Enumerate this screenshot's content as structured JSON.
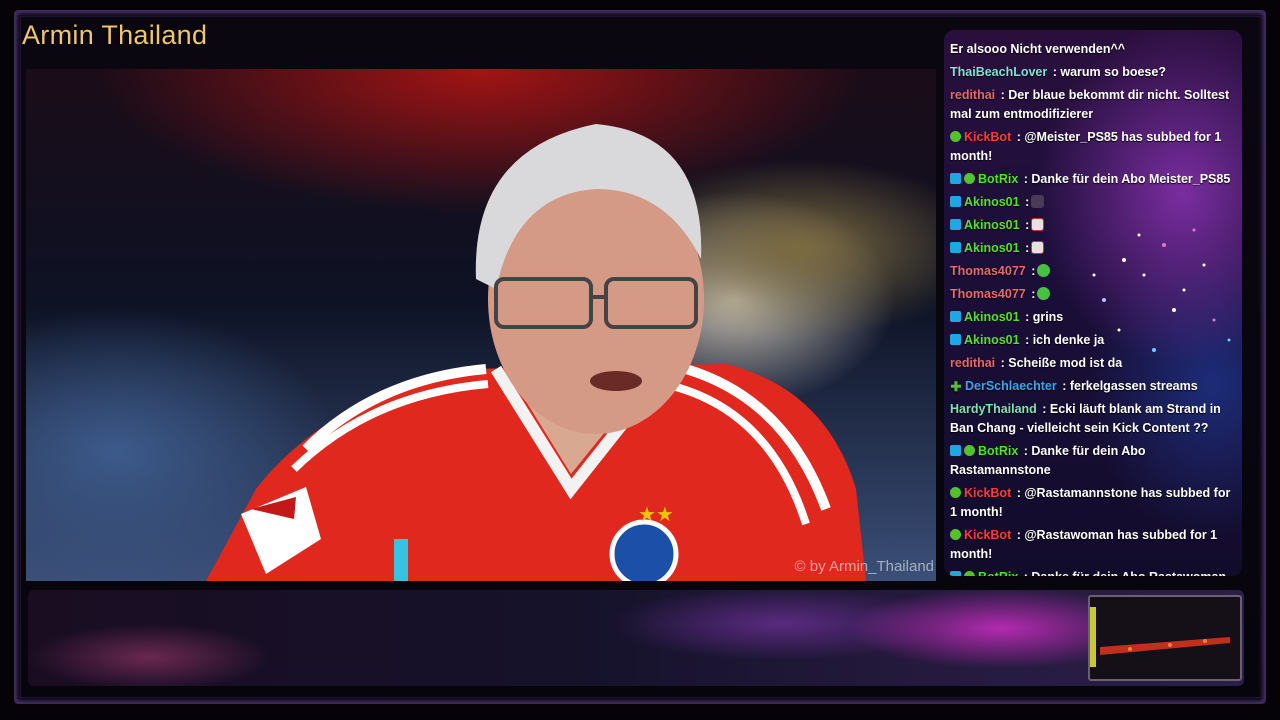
{
  "channel": {
    "title": "Armin Thailand"
  },
  "video": {
    "watermark": "© by Armin_Thailand"
  },
  "chat": {
    "messages": [
      {
        "user": "",
        "color": "#ffffff",
        "badges": [],
        "text": "Er alsooo Nicht verwenden^^"
      },
      {
        "user": "ThaiBeachLover",
        "color": "#7fe3d6",
        "badges": [],
        "text": " : warum so boese?"
      },
      {
        "user": "redithai",
        "color": "#e36a6a",
        "badges": [],
        "text": " : Der blaue bekommt dir nicht. Solltest mal zum entmodifizierer"
      },
      {
        "user": "KickBot",
        "color": "#ff3b3b",
        "badges": [
          "verified"
        ],
        "text": " : @Meister_PS85 has subbed for 1 month!"
      },
      {
        "user": "BotRix",
        "color": "#53e22b",
        "badges": [
          "mod",
          "verified"
        ],
        "text": " : Danke für dein Abo Meister_PS85"
      },
      {
        "user": "Akinos01",
        "color": "#53e22b",
        "badges": [
          "mod"
        ],
        "text": " :",
        "emote": "dark"
      },
      {
        "user": "Akinos01",
        "color": "#53e22b",
        "badges": [
          "mod"
        ],
        "text": " :",
        "emote": "cup"
      },
      {
        "user": "Akinos01",
        "color": "#53e22b",
        "badges": [
          "mod"
        ],
        "text": " :",
        "emote": "cup"
      },
      {
        "user": "Thomas4077",
        "color": "#e86a6a",
        "badges": [],
        "text": " :",
        "emote": "smile"
      },
      {
        "user": "Thomas4077",
        "color": "#e86a6a",
        "badges": [],
        "text": " :",
        "emote": "smile"
      },
      {
        "user": "Akinos01",
        "color": "#53e22b",
        "badges": [
          "mod"
        ],
        "text": " : grins"
      },
      {
        "user": "Akinos01",
        "color": "#53e22b",
        "badges": [
          "mod"
        ],
        "text": " : ich denke ja"
      },
      {
        "user": "redithai",
        "color": "#e36a6a",
        "badges": [],
        "text": " : Scheiße mod ist da"
      },
      {
        "user": "DerSchlaechter",
        "color": "#3aa6e8",
        "badges": [
          "plus"
        ],
        "text": " : ferkelgassen streams"
      },
      {
        "user": "HardyThailand",
        "color": "#7fe3b0",
        "badges": [],
        "text": " : Ecki läuft blank am Strand in Ban Chang - vielleicht sein Kick Content ??"
      },
      {
        "user": "BotRix",
        "color": "#53e22b",
        "badges": [
          "mod",
          "verified"
        ],
        "text": " : Danke für dein Abo Rastamannstone"
      },
      {
        "user": "KickBot",
        "color": "#ff3b3b",
        "badges": [
          "verified"
        ],
        "text": " : @Rastamannstone has subbed for 1 month!"
      },
      {
        "user": "KickBot",
        "color": "#ff3b3b",
        "badges": [
          "verified"
        ],
        "text": " : @Rastawoman has subbed for 1 month!"
      },
      {
        "user": "BotRix",
        "color": "#53e22b",
        "badges": [
          "mod",
          "verified"
        ],
        "text": " : Danke für dein Abo Rastawoman"
      }
    ]
  }
}
